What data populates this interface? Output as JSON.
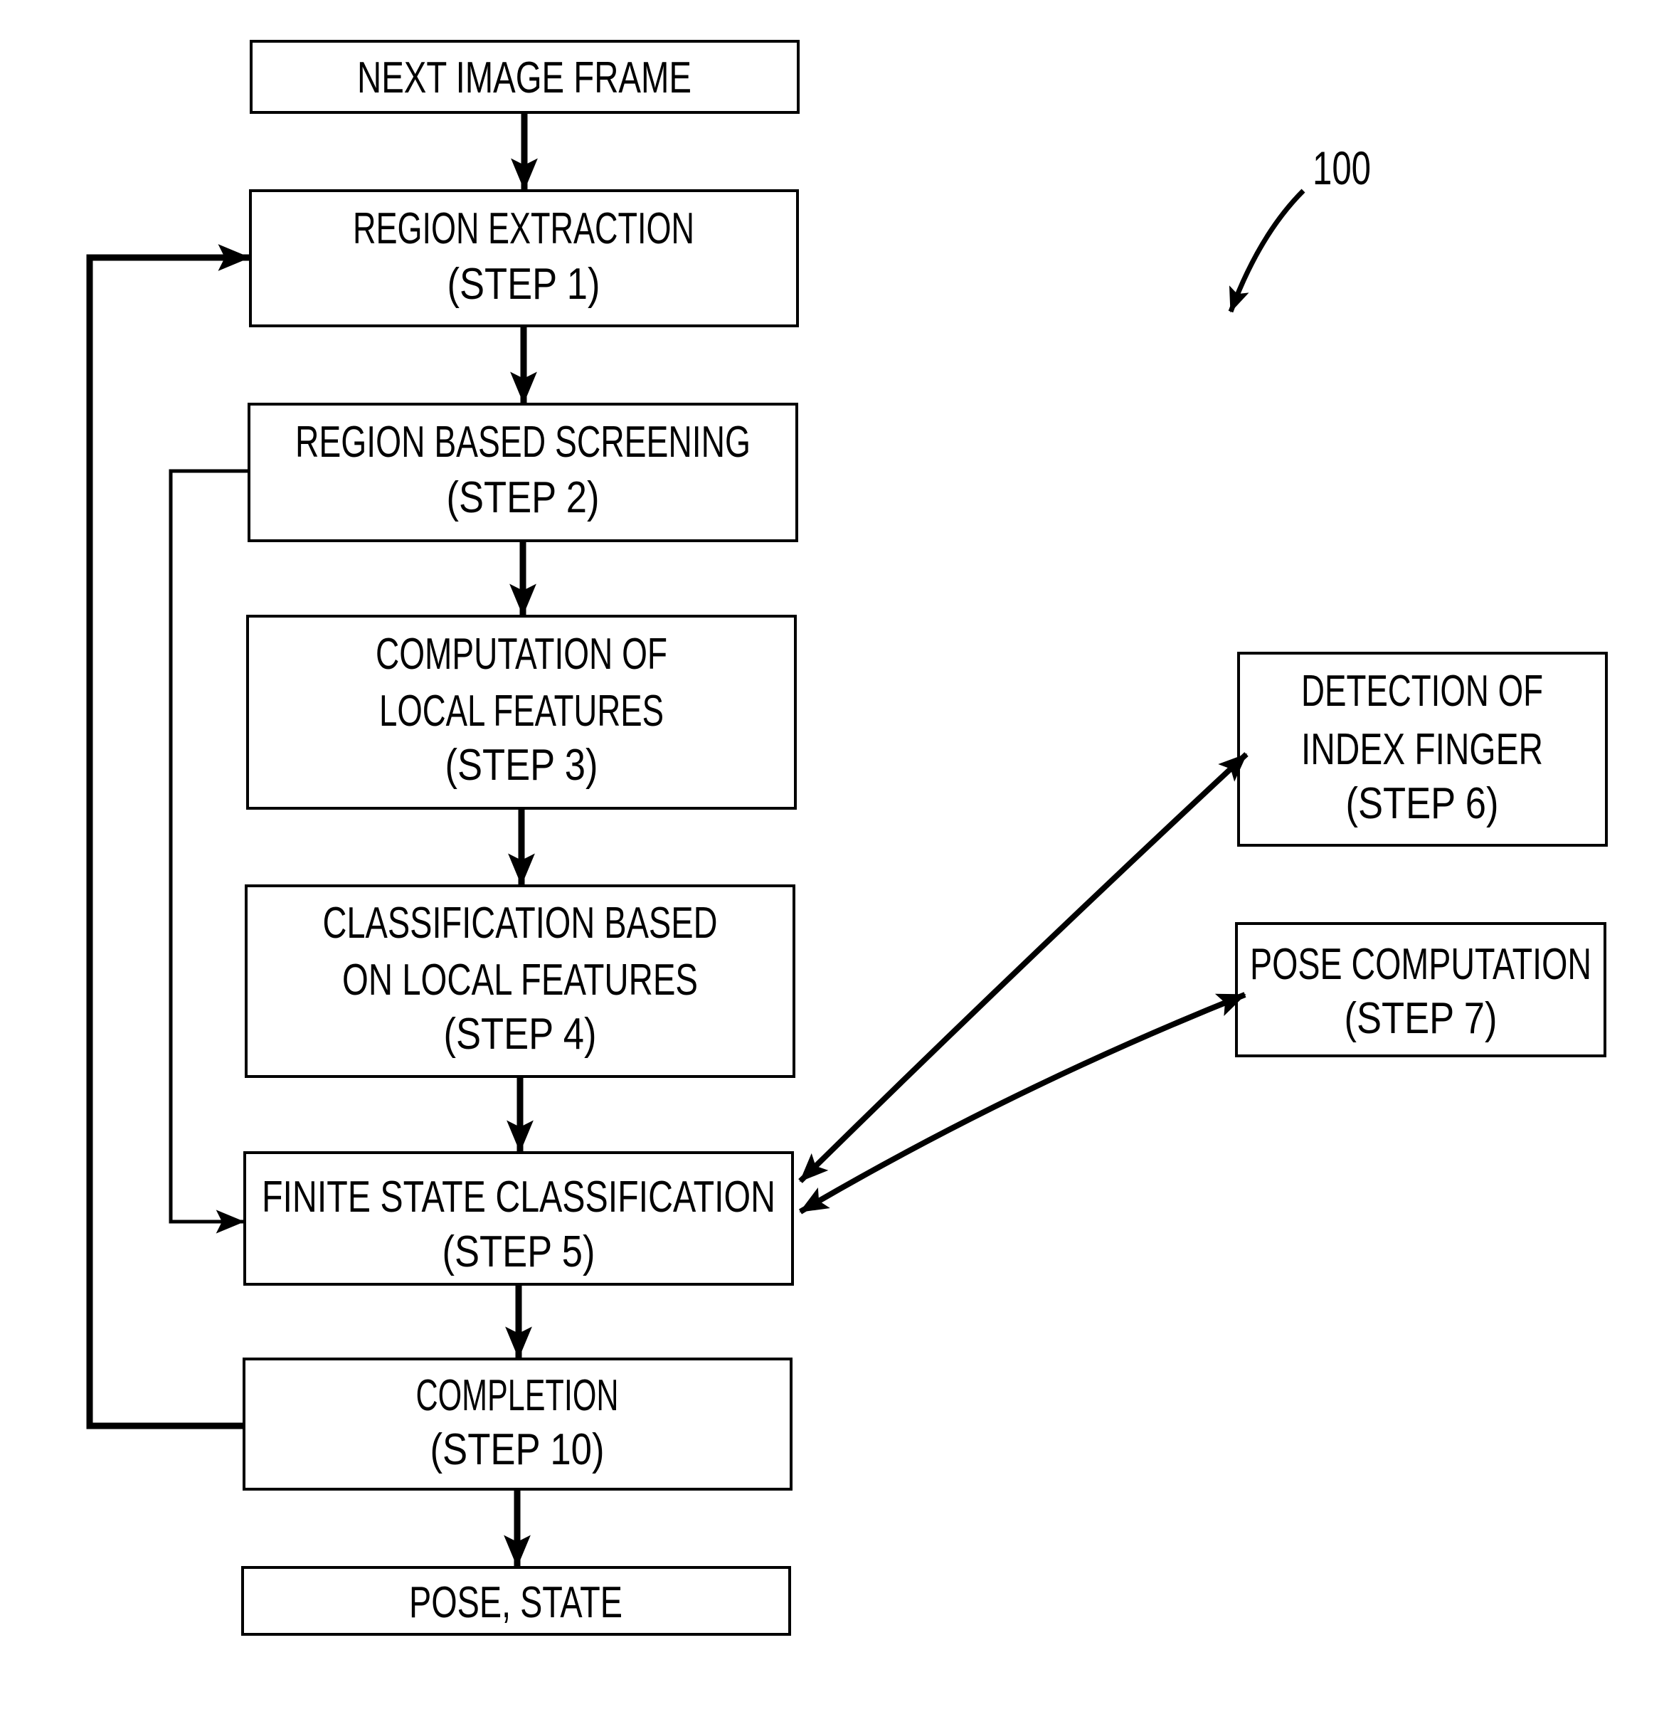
{
  "figure": {
    "reference_numeral": "100",
    "colors": {
      "ink": "#000000",
      "paper": "#ffffff"
    }
  },
  "nodes": {
    "next_image_frame": {
      "lines": [
        "NEXT IMAGE FRAME"
      ]
    },
    "step1": {
      "lines": [
        "REGION EXTRACTION",
        "(STEP 1)"
      ]
    },
    "step2": {
      "lines": [
        "REGION BASED SCREENING",
        "(STEP 2)"
      ]
    },
    "step3": {
      "lines": [
        "COMPUTATION OF",
        "LOCAL FEATURES",
        "(STEP 3)"
      ]
    },
    "step4": {
      "lines": [
        "CLASSIFICATION BASED",
        "ON LOCAL FEATURES",
        "(STEP 4)"
      ]
    },
    "step5": {
      "lines": [
        "FINITE STATE CLASSIFICATION",
        "(STEP 5)"
      ]
    },
    "step6": {
      "lines": [
        "DETECTION OF",
        "INDEX FINGER",
        "(STEP 6)"
      ]
    },
    "step7": {
      "lines": [
        "POSE COMPUTATION",
        "(STEP 7)"
      ]
    },
    "step10": {
      "lines": [
        "COMPLETION",
        "(STEP 10)"
      ]
    },
    "output": {
      "lines": [
        "POSE, STATE"
      ]
    }
  },
  "edges": [
    {
      "from": "next_image_frame",
      "to": "step1",
      "type": "arrow"
    },
    {
      "from": "step1",
      "to": "step2",
      "type": "arrow"
    },
    {
      "from": "step2",
      "to": "step3",
      "type": "arrow"
    },
    {
      "from": "step3",
      "to": "step4",
      "type": "arrow"
    },
    {
      "from": "step4",
      "to": "step5",
      "type": "arrow"
    },
    {
      "from": "step5",
      "to": "step10",
      "type": "arrow"
    },
    {
      "from": "step10",
      "to": "output",
      "type": "arrow"
    },
    {
      "from": "step2",
      "to": "step5",
      "type": "loop-arrow"
    },
    {
      "from": "step10",
      "to": "step1",
      "type": "loop-arrow"
    },
    {
      "from": "step5",
      "to": "step6",
      "type": "bidirectional"
    },
    {
      "from": "step5",
      "to": "step7",
      "type": "bidirectional"
    }
  ]
}
